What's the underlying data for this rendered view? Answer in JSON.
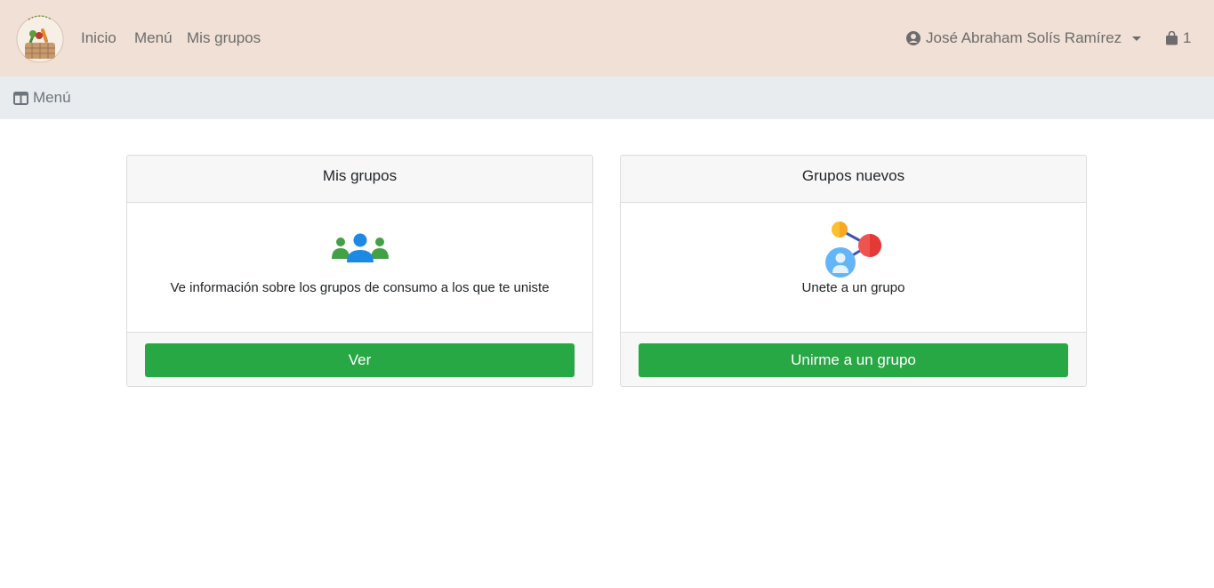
{
  "nav": {
    "logo": "Consumo logo",
    "links": [
      "Inicio",
      "Menú",
      "Mis grupos"
    ],
    "user_name": "José Abraham Solís Ramírez",
    "cart_count": "1"
  },
  "subbar": {
    "menu_label": "Menú"
  },
  "cards": [
    {
      "title": "Mis grupos",
      "icon": "group-people-icon",
      "text": "Ve información sobre los grupos de consumo a los que te uniste",
      "button": "Ver"
    },
    {
      "title": "Grupos nuevos",
      "icon": "network-share-icon",
      "text": "Unete a un grupo",
      "button": "Unirme a un grupo"
    }
  ],
  "colors": {
    "navbar_bg": "#f0e0d5",
    "subbar_bg": "#e9ecef",
    "button_green": "#28a745"
  }
}
